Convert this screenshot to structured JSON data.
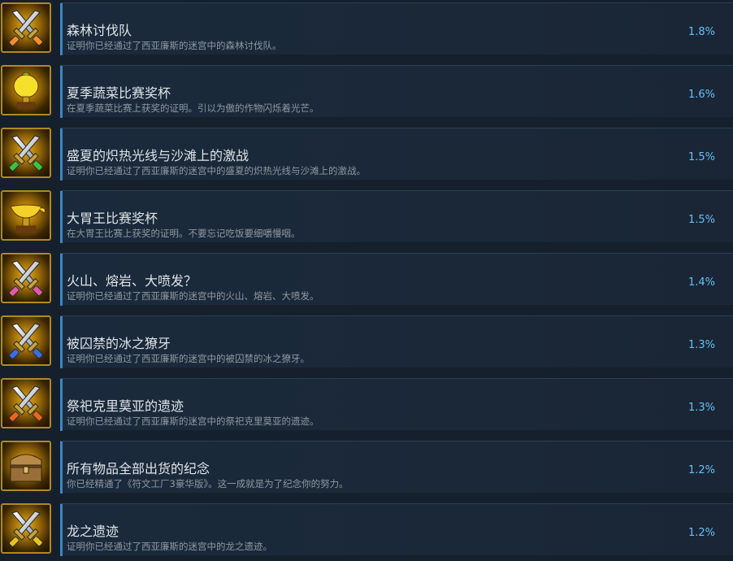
{
  "achievements": [
    {
      "title": "森林讨伐队",
      "description": "证明你已经通过了西亚廉斯的迷宫中的森林讨伐队。",
      "percent": "1.8%",
      "icon": "crossed-swords-icon",
      "accent": "#ff8c2a"
    },
    {
      "title": "夏季蔬菜比赛奖杯",
      "description": "在夏季蔬菜比赛上获奖的证明。引以为傲的作物闪烁着光芒。",
      "percent": "1.6%",
      "icon": "golden-vegetable-trophy-icon",
      "accent": "#f2d21a"
    },
    {
      "title": "盛夏的炽热光线与沙滩上的激战",
      "description": "证明你已经通过了西亚廉斯的迷宫中的盛夏的炽热光线与沙滩上的激战。",
      "percent": "1.5%",
      "icon": "crossed-swords-icon",
      "accent": "#3cc43a"
    },
    {
      "title": "大胃王比赛奖杯",
      "description": "在大胃王比赛上获奖的证明。不要忘记吃饭要细嚼慢咽。",
      "percent": "1.5%",
      "icon": "golden-lamp-trophy-icon",
      "accent": "#f2d21a"
    },
    {
      "title": "火山、熔岩、大喷发？",
      "description": "证明你已经通过了西亚廉斯的迷宫中的火山、熔岩、大喷发。",
      "percent": "1.4%",
      "icon": "crossed-swords-icon",
      "accent": "#e25aa8"
    },
    {
      "title": "被囚禁的冰之獠牙",
      "description": "证明你已经通过了西亚廉斯的迷宫中的被囚禁的冰之獠牙。",
      "percent": "1.3%",
      "icon": "crossed-swords-icon",
      "accent": "#3a6ee0"
    },
    {
      "title": "祭祀克里莫亚的遗迹",
      "description": "证明你已经通过了西亚廉斯的迷宫中的祭祀克里莫亚的遗迹。",
      "percent": "1.3%",
      "icon": "crossed-swords-icon",
      "accent": "#f0641e"
    },
    {
      "title": "所有物品全部出货的纪念",
      "description": "你已经精通了《符文工厂3豪华版》。这一成就是为了纪念你的努力。",
      "percent": "1.2%",
      "icon": "treasure-chest-icon",
      "accent": "#a07840"
    },
    {
      "title": "龙之遗迹",
      "description": "证明你已经通过了西亚廉斯的迷宫中的龙之遗迹。",
      "percent": "1.2%",
      "icon": "crossed-swords-icon",
      "accent": "#e8c21a"
    }
  ]
}
